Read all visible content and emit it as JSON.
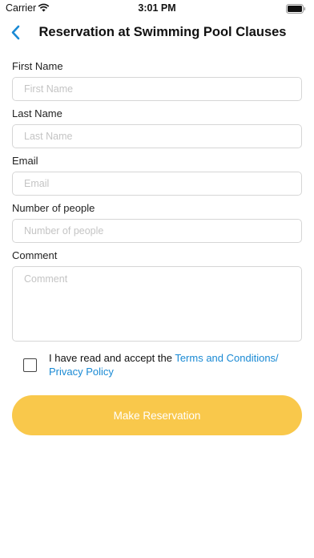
{
  "status_bar": {
    "carrier": "Carrier",
    "time": "3:01 PM"
  },
  "nav": {
    "title": "Reservation at Swimming Pool Clauses"
  },
  "form": {
    "first_name": {
      "label": "First Name",
      "placeholder": "First Name",
      "value": ""
    },
    "last_name": {
      "label": "Last Name",
      "placeholder": "Last Name",
      "value": ""
    },
    "email": {
      "label": "Email",
      "placeholder": "Email",
      "value": ""
    },
    "people": {
      "label": "Number of people",
      "placeholder": "Number of people",
      "value": ""
    },
    "comment": {
      "label": "Comment",
      "placeholder": "Comment",
      "value": ""
    }
  },
  "consent": {
    "checked": false,
    "text": "I have read and accept the ",
    "link_1": "Terms and Conditions/",
    "link_2": "Privacy Policy"
  },
  "submit": {
    "label": "Make Reservation"
  },
  "colors": {
    "accent": "#1a8ad4",
    "button": "#f9c84b"
  },
  "icons": {
    "back": "chevron-left-icon",
    "wifi": "wifi-icon",
    "battery": "battery-icon"
  }
}
